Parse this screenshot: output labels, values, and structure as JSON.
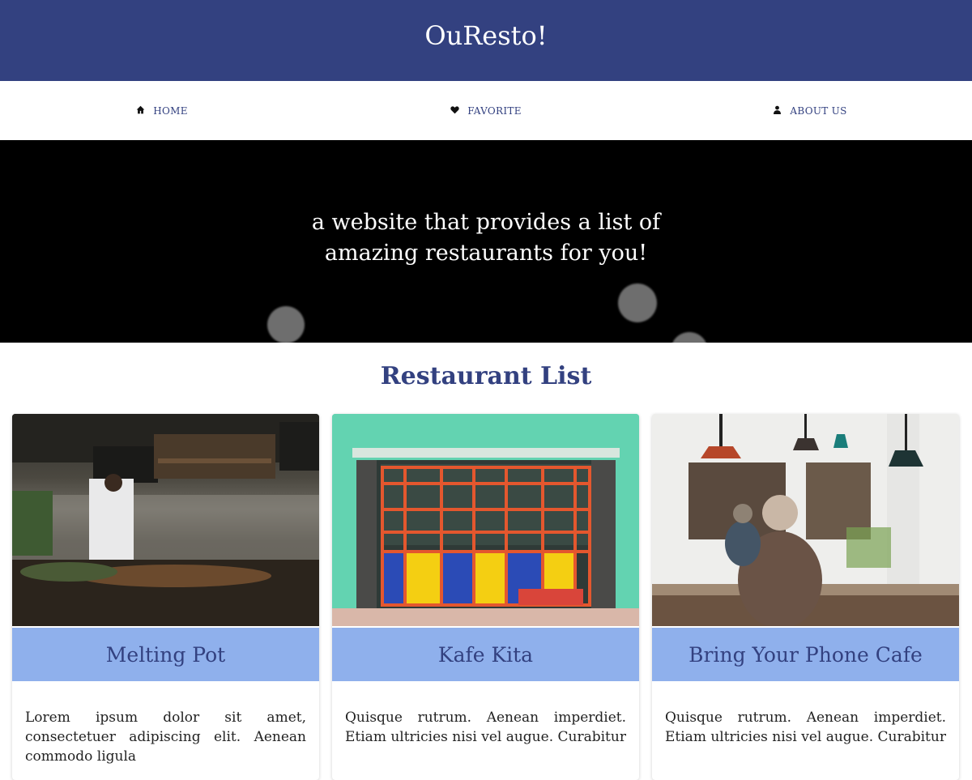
{
  "header": {
    "brand": "OuResto!"
  },
  "nav": {
    "items": [
      {
        "label": "HOME",
        "icon": "home-icon"
      },
      {
        "label": "FAVORITE",
        "icon": "heart-icon"
      },
      {
        "label": "ABOUT US",
        "icon": "user-icon"
      }
    ]
  },
  "hero": {
    "text": "a website that provides a list of amazing restaurants for you!"
  },
  "main": {
    "title": "Restaurant List",
    "restaurants": [
      {
        "name": "Melting Pot",
        "description": "Lorem ipsum dolor sit amet, consectetuer adipiscing elit. Aenean commodo ligula"
      },
      {
        "name": "Kafe Kita",
        "description": "Quisque rutrum. Aenean imperdiet. Etiam ultricies nisi vel augue. Curabitur"
      },
      {
        "name": "Bring Your Phone Cafe",
        "description": "Quisque rutrum. Aenean imperdiet. Etiam ultricies nisi vel augue. Curabitur"
      }
    ]
  },
  "colors": {
    "primary": "#334180",
    "card_title_bg": "#8fb0ec",
    "hero_bg": "#000000"
  }
}
